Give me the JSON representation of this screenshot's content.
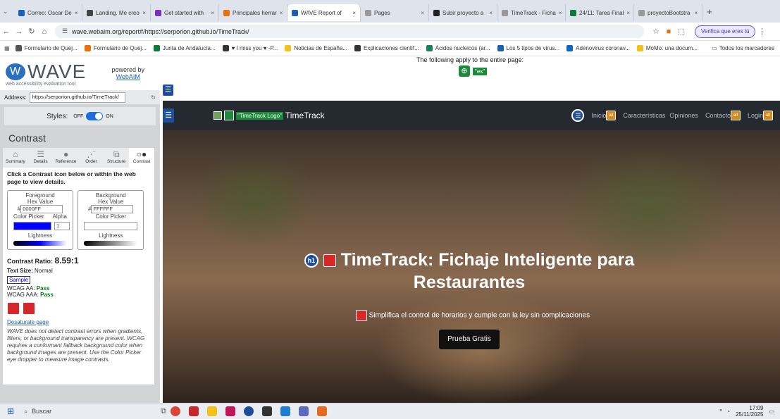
{
  "browser": {
    "tabs": [
      {
        "label": "Correo: Oscar De",
        "color": "#1565c0",
        "active": false
      },
      {
        "label": "Landing. Me creo",
        "color": "#444444",
        "active": false
      },
      {
        "label": "Get started with",
        "color": "#7b2fbe",
        "active": false
      },
      {
        "label": "Principales herrar",
        "color": "#e8710a",
        "active": false
      },
      {
        "label": "WAVE Report of",
        "color": "#1a5fb4",
        "active": true
      },
      {
        "label": "Pages",
        "color": "#999999",
        "active": false
      },
      {
        "label": "Subir proyecto a",
        "color": "#222222",
        "active": false
      },
      {
        "label": "TimeTrack - Ficha",
        "color": "#999999",
        "active": false
      },
      {
        "label": "24/11: Tarea Final",
        "color": "#0b7a3b",
        "active": false
      },
      {
        "label": "proyectoBootstra",
        "color": "#999999",
        "active": false
      }
    ],
    "url": "wave.webaim.org/report#/https://serporion.github.io/TimeTrack/",
    "verify_label": "Verifica que eres tú",
    "bookmarks": [
      "Formulario de Quej...",
      "Formulario de Quej...",
      "Junta de Andalucía...",
      "♥ I miss you ♥ -P...",
      "Noticias de España...",
      "Explicaciones cientif...",
      "Ácidos nucleicos (ar...",
      "Los 5 tipos de virus...",
      "Adenovirus coronav...",
      "MoMo: una docum..."
    ],
    "all_bookmarks": "Todos los marcadores"
  },
  "wave": {
    "logo": "WAVE",
    "subtitle": "web accessibility evaluation tool",
    "powered": "powered by",
    "webaim": "WebAIM",
    "address_label": "Address:",
    "address_value": "https://serporion.github.io/TimeTrack/",
    "styles_label": "Styles:",
    "styles_off": "OFF",
    "styles_on": "ON",
    "panel_title": "Contrast",
    "nav": [
      "Summary",
      "Details",
      "Reference",
      "Order",
      "Structure",
      "Contrast"
    ],
    "instructions": "Click a Contrast icon below or within the web page to view details.",
    "foreground_legend": "Foreground",
    "background_legend": "Background",
    "hex_label": "Hex Value",
    "fg_hex": "0000FF",
    "bg_hex": "FFFFFF",
    "fg_color": "#0000FF",
    "bg_color": "#FFFFFF",
    "color_picker": "Color Picker",
    "alpha_label": "Alpha",
    "alpha_value": "1",
    "lightness_label": "Lightness",
    "ratio_label": "Contrast Ratio:",
    "ratio_value": "8.59:1",
    "text_size_label": "Text Size:",
    "text_size_value": "Normal",
    "sample": "Sample",
    "aa_label": "WCAG AA:",
    "aa_value": "Pass",
    "aaa_label": "WCAG AAA:",
    "aaa_value": "Pass",
    "desaturate": "Desaturate page",
    "note": "WAVE does not detect contrast errors when gradients, filters, or background transparency are present. WCAG requires a conformant fallback background color when background images are present. Use the Color Picker eye dropper to measure image contrasts."
  },
  "page": {
    "apply_text": "The following apply to the entire page:",
    "lang_badge": "\"es\"",
    "logo_alt": "\"TimeTrack Logo\"",
    "brand": "TimeTrack",
    "nav_links": [
      "Inicio",
      "Características",
      "Opiniones",
      "Contacto",
      "Login"
    ],
    "hero_title": "TimeTrack: Fichaje Inteligente para Restaurantes",
    "h1_badge": "h1",
    "hero_subtitle": "Simplifica el control de horarios y cumple con la ley sin complicaciones",
    "cta": "Prueba Gratis",
    "alt_badge": "alt"
  },
  "taskbar": {
    "search": "Buscar",
    "time": "17:09",
    "date": "25/11/2025"
  }
}
